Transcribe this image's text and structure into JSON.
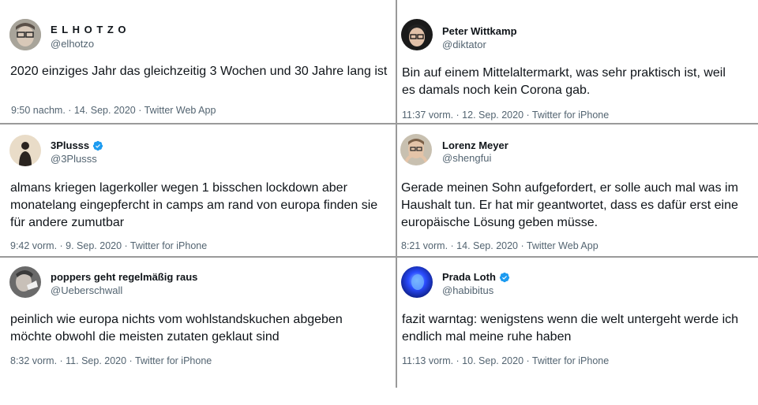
{
  "tweets": [
    {
      "name": "E L H O T Z O",
      "handle": "@elhotzo",
      "verified": false,
      "text": "2020 einziges Jahr das gleichzeitig 3 Wochen und 30 Jahre lang ist",
      "meta": "9:50 nachm. · 14. Sep. 2020 · Twitter Web App"
    },
    {
      "name": "Peter Wittkamp",
      "handle": "@diktator",
      "verified": false,
      "text": "Bin auf einem Mittelaltermarkt, was sehr praktisch ist, weil\nes damals noch kein Corona gab.",
      "meta": "11:37 vorm. · 12. Sep. 2020 · Twitter for iPhone"
    },
    {
      "name": "3Plusss",
      "handle": "@3Plusss",
      "verified": true,
      "text": "almans kriegen lagerkoller wegen 1 bisschen lockdown aber\nmonatelang eingepfercht in camps am rand von europa finden sie\nfür andere zumutbar",
      "meta": "9:42 vorm. · 9. Sep. 2020 · Twitter for iPhone"
    },
    {
      "name": "Lorenz Meyer",
      "handle": "@shengfui",
      "verified": false,
      "text": "Gerade meinen Sohn aufgefordert, er solle auch mal was im\nHaushalt tun. Er hat mir geantwortet, dass es dafür erst eine\neuropäische Lösung geben müsse.",
      "meta": "8:21 vorm. · 14. Sep. 2020 · Twitter Web App"
    },
    {
      "name": "poppers geht regelmäßig raus",
      "handle": "@Ueberschwall",
      "verified": false,
      "text": "peinlich wie europa nichts vom wohlstandskuchen abgeben\nmöchte  obwohl die meisten zutaten geklaut sind",
      "meta": "8:32 vorm. · 11. Sep. 2020 · Twitter for iPhone"
    },
    {
      "name": "Prada Loth",
      "handle": "@habibitus",
      "verified": true,
      "text": "fazit warntag: wenigstens wenn die welt untergeht werde ich\nendlich mal meine ruhe haben",
      "meta": "11:13 vorm. · 10. Sep. 2020 · Twitter for iPhone"
    }
  ],
  "colors": {
    "text": "#0f1419",
    "secondary": "#536471",
    "verified": "#1d9bf0",
    "divider": "#9a9a9a"
  }
}
